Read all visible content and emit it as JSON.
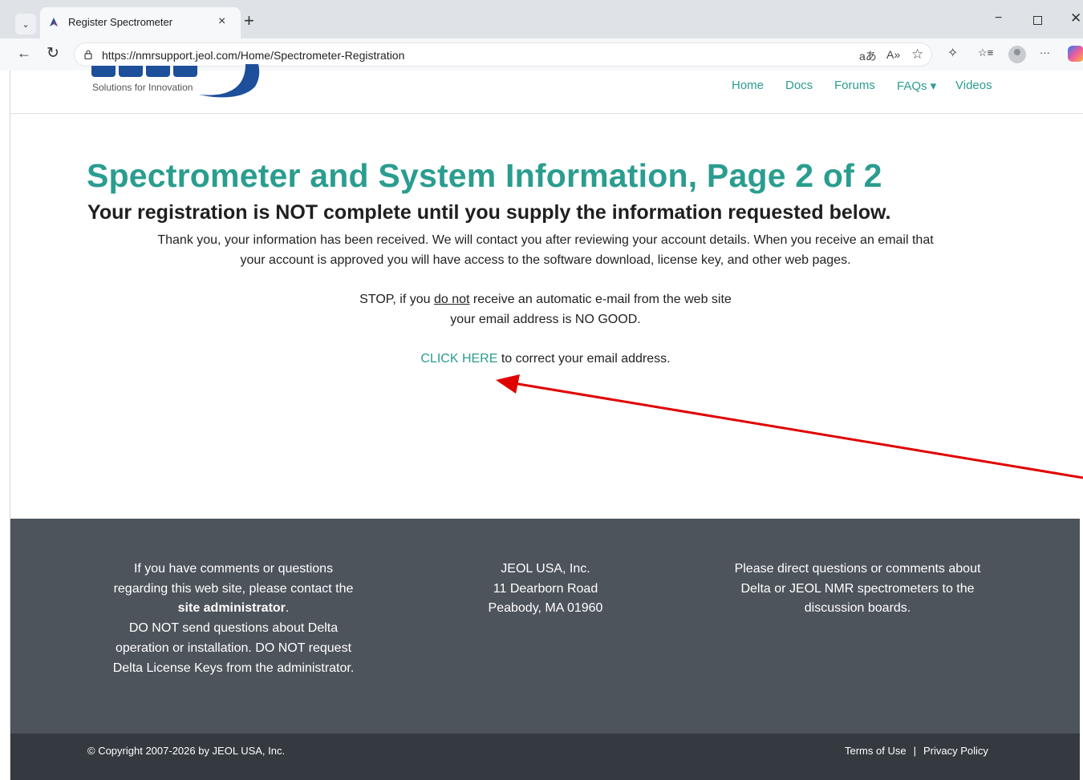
{
  "browser": {
    "tab_title": "Register Spectrometer",
    "url": "https://nmrsupport.jeol.com/Home/Spectrometer-Registration",
    "tab_close_glyph": "×",
    "new_tab_glyph": "+",
    "min_glyph": "−",
    "close_glyph": "✕",
    "back_glyph": "←",
    "reload_glyph": "↻",
    "read_aloud_glyph": "aあ",
    "font_glyph": "A»",
    "favorite_glyph": "☆",
    "extensions_glyph": "✧",
    "collections_glyph": "☆≡",
    "more_glyph": "···"
  },
  "site": {
    "logo_tagline": "Solutions for Innovation",
    "nav": {
      "home": "Home",
      "docs": "Docs",
      "forums": "Forums",
      "faqs": "FAQs ▾",
      "videos": "Videos"
    }
  },
  "content": {
    "title": "Spectrometer and System Information, Page 2 of 2",
    "subtitle": "Your registration is NOT complete until you supply the information requested below.",
    "thank_you_1": "Thank you, your information has been received. We will contact you after reviewing your account details. When you receive an email that",
    "thank_you_2": "your account is approved you will have access to the software download, license key, and other web pages.",
    "stop_pre": "STOP, if you ",
    "stop_underline": "do not",
    "stop_post": " receive an automatic e-mail from the web site",
    "no_good": "your email address is NO GOOD.",
    "click_here": "CLICK HERE",
    "click_after": " to correct your email address."
  },
  "footer": {
    "left_1": "If you have comments or questions",
    "left_2": "regarding this web site, please contact the",
    "left_admin": "site administrator",
    "left_admin_dot": ".",
    "left_3": "DO NOT send questions about Delta",
    "left_4": "operation or installation. DO NOT request",
    "left_5": "Delta License Keys from the administrator.",
    "mid_1": "JEOL USA, Inc.",
    "mid_2": "11 Dearborn Road",
    "mid_3": "Peabody, MA 01960",
    "right_1": "Please direct questions or comments about",
    "right_2": "Delta or JEOL NMR spectrometers to the",
    "right_3": "discussion boards.",
    "copyright": "© Copyright 2007-2026 by JEOL USA, Inc.",
    "terms": "Terms of Use",
    "separator": "|",
    "privacy": "Privacy Policy"
  },
  "colors": {
    "accent_teal": "#2a9d8f",
    "footer_bg": "#4d545c",
    "bottombar_bg": "#343a40",
    "arrow_red": "#e00000"
  }
}
